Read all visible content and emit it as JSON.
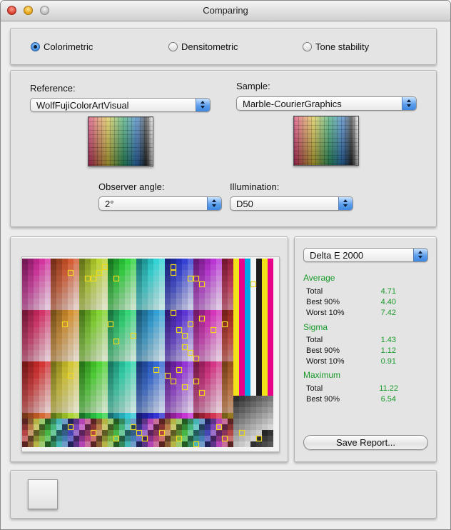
{
  "window": {
    "title": "Comparing"
  },
  "mode": {
    "options": [
      "Colorimetric",
      "Densitometric",
      "Tone stability"
    ],
    "selected": "Colorimetric"
  },
  "reference": {
    "label": "Reference:",
    "value": "WolfFujiColorArtVisual"
  },
  "sample": {
    "label": "Sample:",
    "value": "Marble-CourierGraphics"
  },
  "observer": {
    "label": "Observer angle:",
    "value": "2°"
  },
  "illumination": {
    "label": "Illumination:",
    "value": "D50"
  },
  "metric": {
    "value": "Delta E 2000"
  },
  "stats": {
    "average": {
      "title": "Average",
      "rows": [
        {
          "label": "Total",
          "value": "4.71"
        },
        {
          "label": "Best 90%",
          "value": "4.40"
        },
        {
          "label": "Worst 10%",
          "value": "7.42"
        }
      ]
    },
    "sigma": {
      "title": "Sigma",
      "rows": [
        {
          "label": "Total",
          "value": "1.43"
        },
        {
          "label": "Best 90%",
          "value": "1.12"
        },
        {
          "label": "Worst 10%",
          "value": "0.91"
        }
      ]
    },
    "maximum": {
      "title": "Maximum",
      "rows": [
        {
          "label": "Total",
          "value": "11.22"
        },
        {
          "label": "Best 90%",
          "value": "6.54"
        }
      ]
    }
  },
  "buttons": {
    "save_report": "Save Report..."
  },
  "colors": {
    "stat_green": "#1a9a2a",
    "highlight": "#f0d81c"
  }
}
